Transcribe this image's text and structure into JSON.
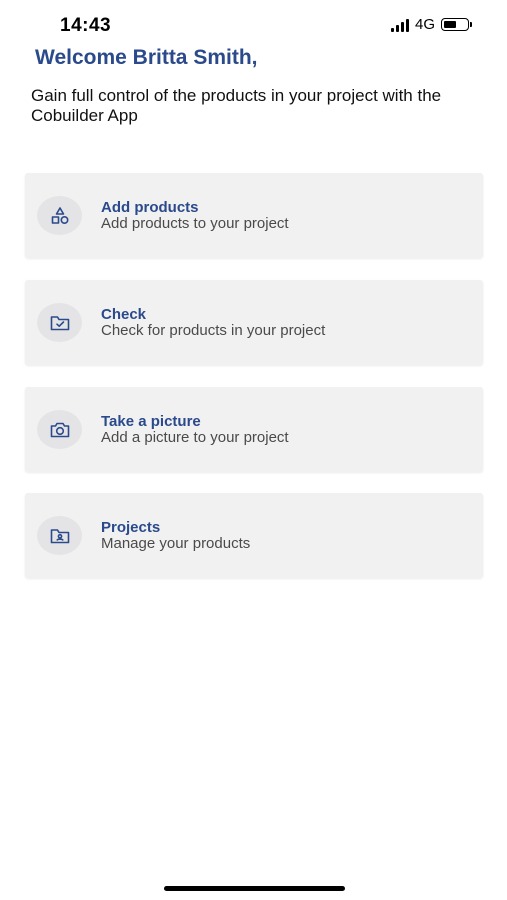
{
  "status_bar": {
    "time": "14:43",
    "network": "4G"
  },
  "header": {
    "welcome": "Welcome Britta Smith,",
    "subtitle": "Gain full control of the products in your project with the Cobuilder App"
  },
  "actions": [
    {
      "title": "Add products",
      "description": "Add products to your project",
      "icon": "shapes-icon"
    },
    {
      "title": "Check",
      "description": "Check for products in your project",
      "icon": "folder-check-icon"
    },
    {
      "title": "Take a picture",
      "description": "Add a picture to your project",
      "icon": "camera-icon"
    },
    {
      "title": "Projects",
      "description": "Manage your products",
      "icon": "folder-user-icon"
    }
  ],
  "colors": {
    "accent": "#2b4a8c",
    "card_bg": "#f1f1f1",
    "icon_bg": "#e4e4e6"
  }
}
